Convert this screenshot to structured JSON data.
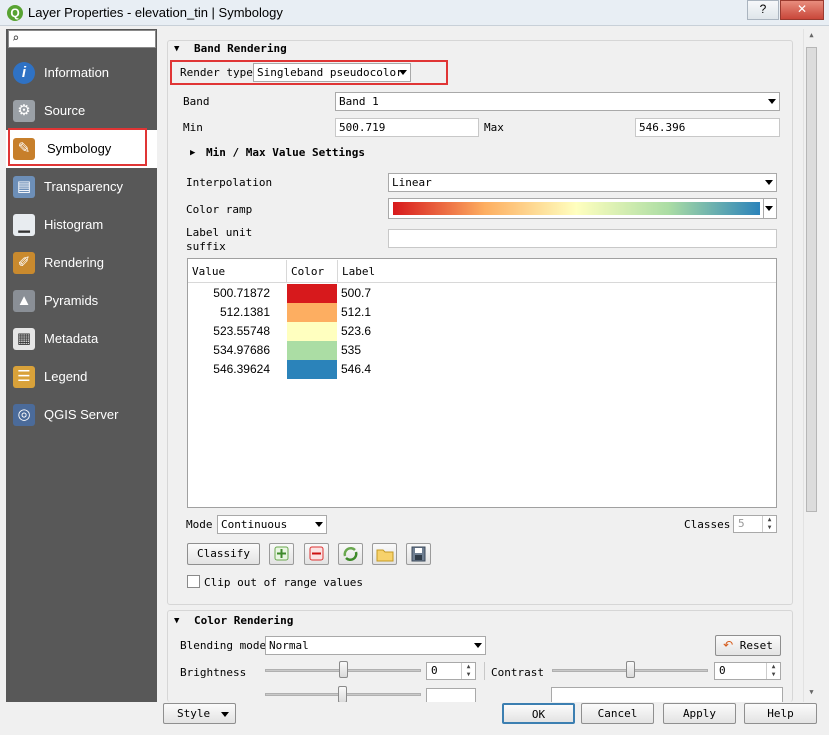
{
  "window": {
    "title": "Layer Properties - elevation_tin | Symbology",
    "logo": "Q",
    "help_btn": "?",
    "close_btn": "✕"
  },
  "sidebar": {
    "search_icon": "magnifier-icon",
    "items": [
      {
        "label": "Information",
        "icon": "info-icon",
        "active": false
      },
      {
        "label": "Source",
        "icon": "source-icon",
        "active": false
      },
      {
        "label": "Symbology",
        "icon": "symbology-icon",
        "active": true
      },
      {
        "label": "Transparency",
        "icon": "transparency-icon",
        "active": false
      },
      {
        "label": "Histogram",
        "icon": "histogram-icon",
        "active": false
      },
      {
        "label": "Rendering",
        "icon": "rendering-icon",
        "active": false
      },
      {
        "label": "Pyramids",
        "icon": "pyramids-icon",
        "active": false
      },
      {
        "label": "Metadata",
        "icon": "metadata-icon",
        "active": false
      },
      {
        "label": "Legend",
        "icon": "legend-icon",
        "active": false
      },
      {
        "label": "QGIS Server",
        "icon": "qgis-server-icon",
        "active": false
      }
    ]
  },
  "band_rendering": {
    "title": "Band Rendering",
    "render_type_label": "Render type",
    "render_type_value": "Singleband pseudocolor",
    "band_label": "Band",
    "band_value": "Band 1",
    "min_label": "Min",
    "min_value": "500.719",
    "max_label": "Max",
    "max_value": "546.396",
    "minmax_settings": "Min / Max Value Settings",
    "interpolation_label": "Interpolation",
    "interpolation_value": "Linear",
    "color_ramp_label": "Color ramp",
    "label_unit_label_1": "Label unit",
    "label_unit_label_2": "suffix",
    "label_unit_value": "",
    "table": {
      "headers": [
        "Value",
        "Color",
        "Label"
      ],
      "rows": [
        {
          "value": "500.71872",
          "color": "#d7191c",
          "label": "500.7"
        },
        {
          "value": "512.1381",
          "color": "#fdae61",
          "label": "512.1"
        },
        {
          "value": "523.55748",
          "color": "#ffffbf",
          "label": "523.6"
        },
        {
          "value": "534.97686",
          "color": "#abdda4",
          "label": "535"
        },
        {
          "value": "546.39624",
          "color": "#2b83ba",
          "label": "546.4"
        }
      ]
    },
    "mode_label": "Mode",
    "mode_value": "Continuous",
    "classes_label": "Classes",
    "classes_value": "5",
    "classify_btn": "Classify",
    "clip_label": "Clip out of range values"
  },
  "color_rendering": {
    "title": "Color Rendering",
    "blending_label": "Blending mode",
    "blending_value": "Normal",
    "reset_btn": "Reset",
    "brightness_label": "Brightness",
    "brightness_value": "0",
    "brightness_level": 0.5,
    "contrast_label": "Contrast",
    "contrast_value": "0",
    "contrast_level": 0.5
  },
  "footer": {
    "style_btn": "Style",
    "ok_btn": "OK",
    "cancel_btn": "Cancel",
    "apply_btn": "Apply",
    "help_btn": "Help"
  },
  "colors": {
    "highlight": "#e03535",
    "sidebar_bg": "#585858",
    "ramp": [
      "#d7191c",
      "#fdae61",
      "#ffffbf",
      "#abdda4",
      "#2b83ba"
    ]
  }
}
